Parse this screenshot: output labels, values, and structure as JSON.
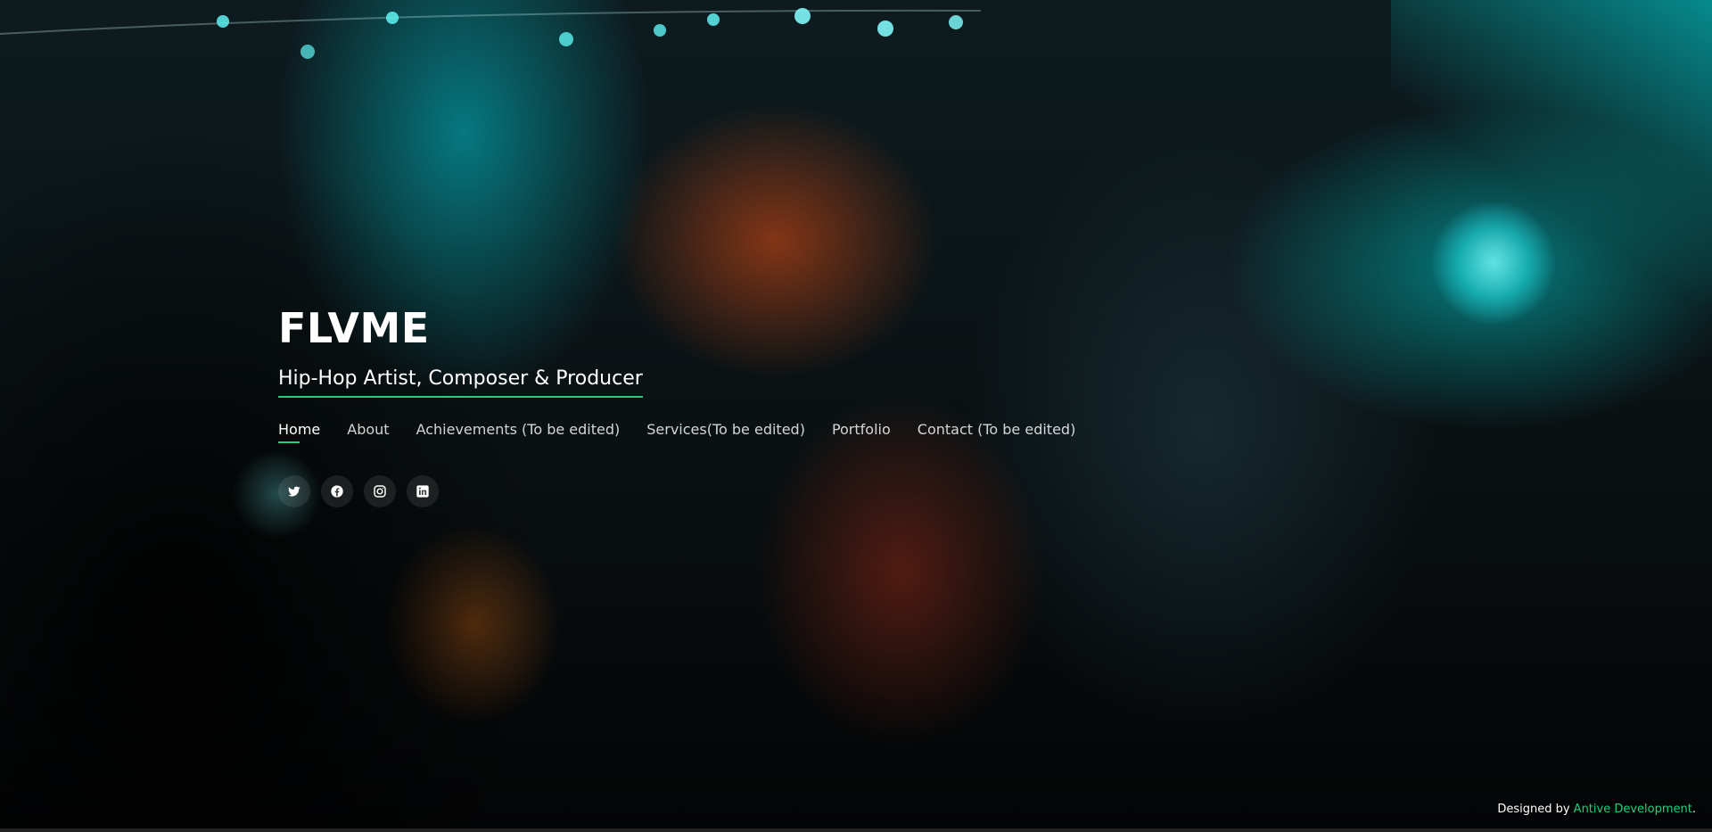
{
  "header": {
    "title": "FLVME",
    "subtitle": "Hip-Hop Artist, Composer & Producer"
  },
  "nav": {
    "items": [
      {
        "label": "Home",
        "active": true
      },
      {
        "label": "About"
      },
      {
        "label": "Achievements (To be edited)"
      },
      {
        "label": "Services(To be edited)"
      },
      {
        "label": "Portfolio"
      },
      {
        "label": "Contact (To be edited)"
      }
    ]
  },
  "social": {
    "icons": [
      "twitter-icon",
      "facebook-icon",
      "instagram-icon",
      "linkedin-icon"
    ]
  },
  "footer": {
    "credit_prefix": "Designed by",
    "credit_link": "Antive Development",
    "credit_suffix": "."
  },
  "colors": {
    "accent": "#1fcf7a",
    "text": "#ffffff"
  }
}
